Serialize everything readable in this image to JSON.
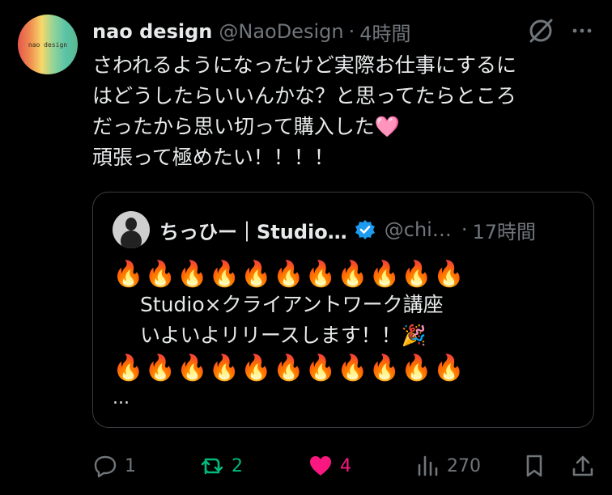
{
  "post": {
    "avatar_text": "nao design",
    "name": "nao design",
    "handle": "@NaoDesign",
    "separator": "·",
    "time": "4時間",
    "more_icon": "more-icon",
    "grok_icon": "grok-icon",
    "lines": [
      "さわれるようになったけど実際お仕事にするに",
      "はどうしたらいいんかな？と思ってたらところ",
      "だったから思い切って購入した",
      "頑張って極めたい！！！！"
    ],
    "heart_emoji": "🩷"
  },
  "quote": {
    "name": "ちっひー｜Studio…",
    "handle": "@chi…",
    "separator": "·",
    "time": "17時間",
    "fires_row": "🔥🔥🔥🔥🔥🔥🔥🔥🔥🔥🔥",
    "line1": "Studio×クライアントワーク講座",
    "line2": "いよいよリリースします！！",
    "party_emoji": "🎉",
    "ellipsis": "..."
  },
  "actions": {
    "replies": "1",
    "reposts": "2",
    "likes": "4",
    "views": "270"
  },
  "colors": {
    "background": "#000000",
    "text": "#e7e9ea",
    "muted": "#71767b",
    "repost_green": "#00ba7c",
    "like_pink": "#f91880",
    "verified_blue": "#1d9bf0"
  }
}
